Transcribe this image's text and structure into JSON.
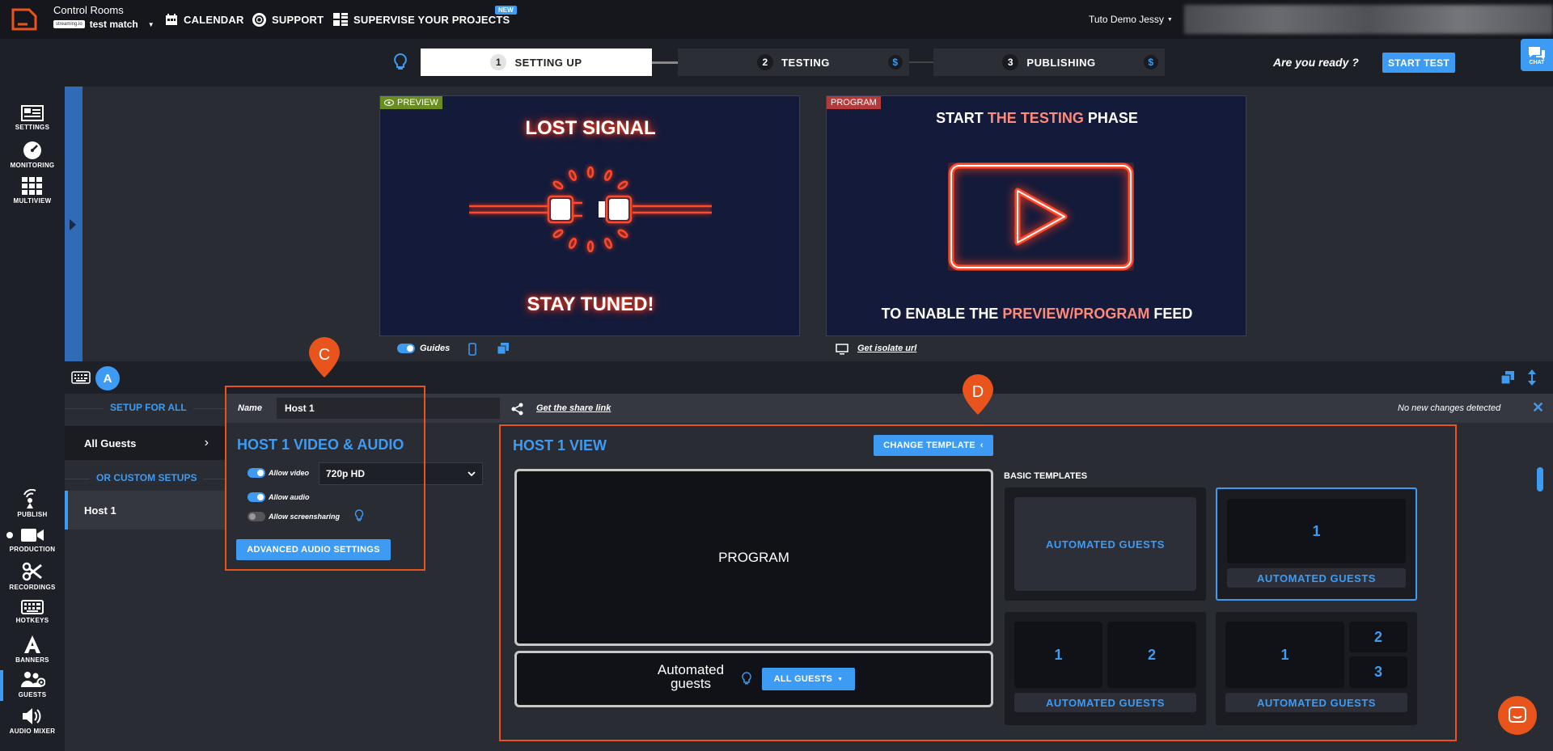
{
  "topbar": {
    "app_name": "Control Rooms",
    "project_logo_text": "streaming.io",
    "project_name": "test match",
    "nav": [
      {
        "label": "CALENDAR"
      },
      {
        "label": "SUPPORT"
      },
      {
        "label": "SUPERVISE YOUR PROJECTS",
        "badge": "NEW"
      }
    ],
    "user": "Tuto Demo Jessy",
    "chat_label": "CHAT"
  },
  "steps": [
    {
      "num": "1",
      "label": "SETTING UP",
      "active": true
    },
    {
      "num": "2",
      "label": "TESTING",
      "dollar": "$"
    },
    {
      "num": "3",
      "label": "PUBLISHING",
      "dollar": "$"
    }
  ],
  "ready_text": "Are you ready ?",
  "start_test": "START TEST",
  "left_rail_top": [
    {
      "label": "SETTINGS",
      "icon": "settings-icon"
    },
    {
      "label": "MONITORING",
      "icon": "gauge-icon"
    },
    {
      "label": "MULTIVIEW",
      "icon": "grid-icon"
    }
  ],
  "left_rail_bottom": [
    {
      "label": "PUBLISH",
      "icon": "broadcast-icon"
    },
    {
      "label": "PRODUCTION",
      "icon": "camera-icon"
    },
    {
      "label": "RECORDINGS",
      "icon": "scissors-icon"
    },
    {
      "label": "HOTKEYS",
      "icon": "keyboard-icon"
    },
    {
      "label": "BANNERS",
      "icon": "letter-a-icon"
    },
    {
      "label": "GUESTS",
      "icon": "guests-icon"
    },
    {
      "label": "AUDIO MIXER",
      "icon": "speaker-icon"
    }
  ],
  "preview": {
    "tag": "PREVIEW",
    "title": "LOST SIGNAL",
    "subtitle": "STAY TUNED!",
    "guides_label": "Guides"
  },
  "program": {
    "tag": "PROGRAM",
    "line1_a": "START ",
    "line1_b": "THE TESTING",
    "line1_c": " PHASE",
    "line2_a": "TO ENABLE THE ",
    "line2_b": "PREVIEW/PROGRAM",
    "line2_c": " FEED",
    "isolate_link": "Get isolate url"
  },
  "toolbar2": {
    "avatar": "A"
  },
  "setup": {
    "setup_for_all": "SETUP FOR ALL",
    "all_guests": "All Guests",
    "or_custom": "OR CUSTOM SETUPS",
    "host_item": "Host 1"
  },
  "namebar": {
    "name_label": "Name",
    "name_value": "Host 1",
    "share_link": "Get the share link",
    "no_changes": "No new changes detected"
  },
  "host_settings": {
    "title": "HOST 1 VIDEO & AUDIO",
    "allow_video": "Allow video",
    "video_quality": "720p HD",
    "allow_audio": "Allow audio",
    "allow_screensharing": "Allow screensharing",
    "advanced_audio": "ADVANCED AUDIO SETTINGS"
  },
  "host_view": {
    "title": "HOST 1 VIEW",
    "change_template": "CHANGE TEMPLATE",
    "program_label": "PROGRAM",
    "automated_guests": "Automated guests",
    "all_guests_button": "ALL GUESTS",
    "basic_templates": "BASIC TEMPLATES",
    "template_label": "AUTOMATED GUESTS",
    "slot_1": "1",
    "slot_2": "2",
    "slot_3": "3"
  },
  "callouts": {
    "c": "C",
    "d": "D"
  },
  "colors": {
    "accent": "#3d9bf3",
    "callout": "#e9541d",
    "preview_tag": "#6a8d1f",
    "program_tag": "#b53a3a"
  }
}
